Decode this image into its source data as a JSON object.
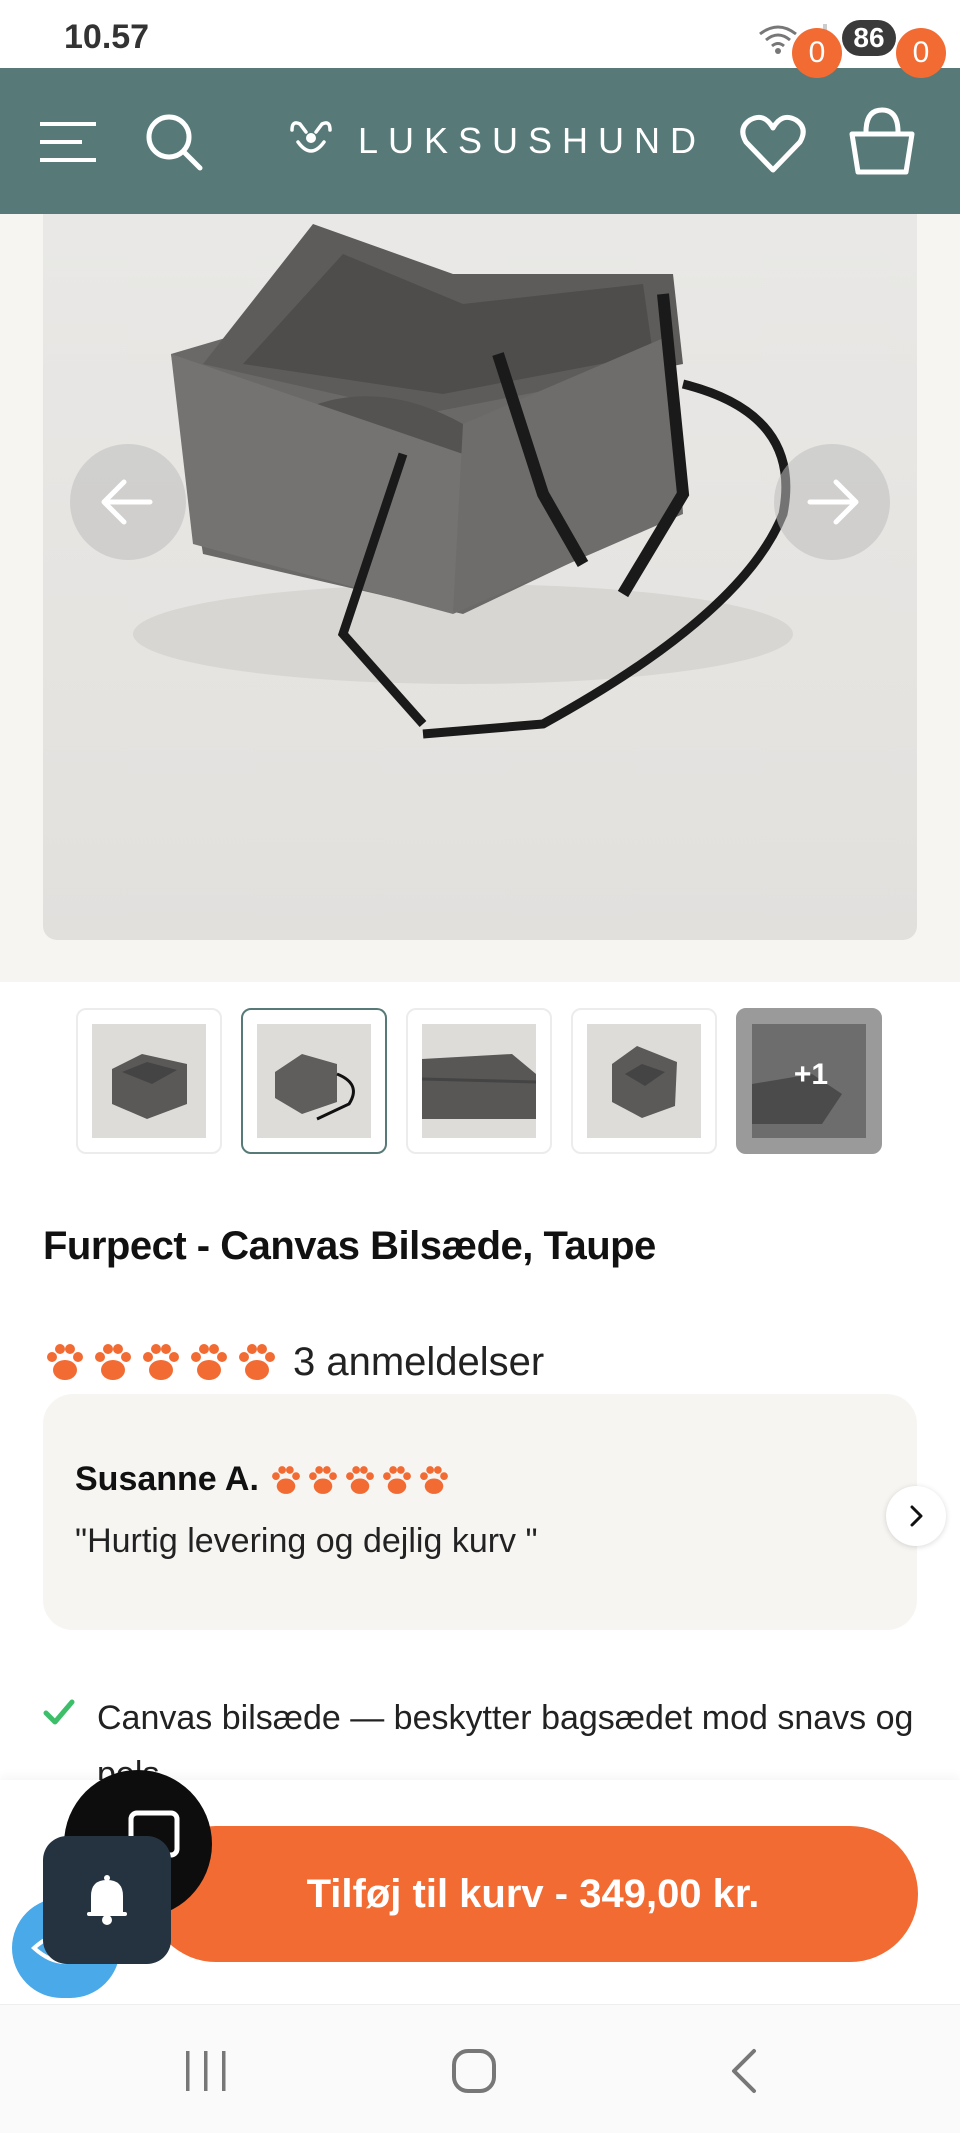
{
  "status_bar": {
    "time": "10.57",
    "battery": "86",
    "wifi_icon": "wifi-icon",
    "signal_icon": "signal-icon"
  },
  "header": {
    "brand": "LUKSUSHUND",
    "wishlist_count": "0",
    "cart_count": "0",
    "background_color": "#577a78",
    "icons": [
      "menu-icon",
      "search-icon",
      "logo-icon",
      "heart-icon",
      "basket-icon"
    ]
  },
  "gallery": {
    "thumbnails": [
      {
        "label": ""
      },
      {
        "label": ""
      },
      {
        "label": ""
      },
      {
        "label": ""
      },
      {
        "label": "+1"
      }
    ]
  },
  "product": {
    "title": "Furpect - Canvas Bilsæde, Taupe",
    "rating_stars": 5,
    "review_count_text": "3 anmeldelser"
  },
  "review": {
    "author": "Susanne A.",
    "stars": 5,
    "quote": "\"Hurtig levering og dejlig kurv \""
  },
  "features": [
    {
      "text": "Canvas bilsæde — beskytter bagsædet mod snavs og pels"
    }
  ],
  "cta": {
    "label": "Tilføj til kurv - 349,00 kr.",
    "color": "#f26b33"
  },
  "colors": {
    "accent": "#f26b33",
    "brand": "#577a78",
    "check": "#3dbf6a"
  }
}
